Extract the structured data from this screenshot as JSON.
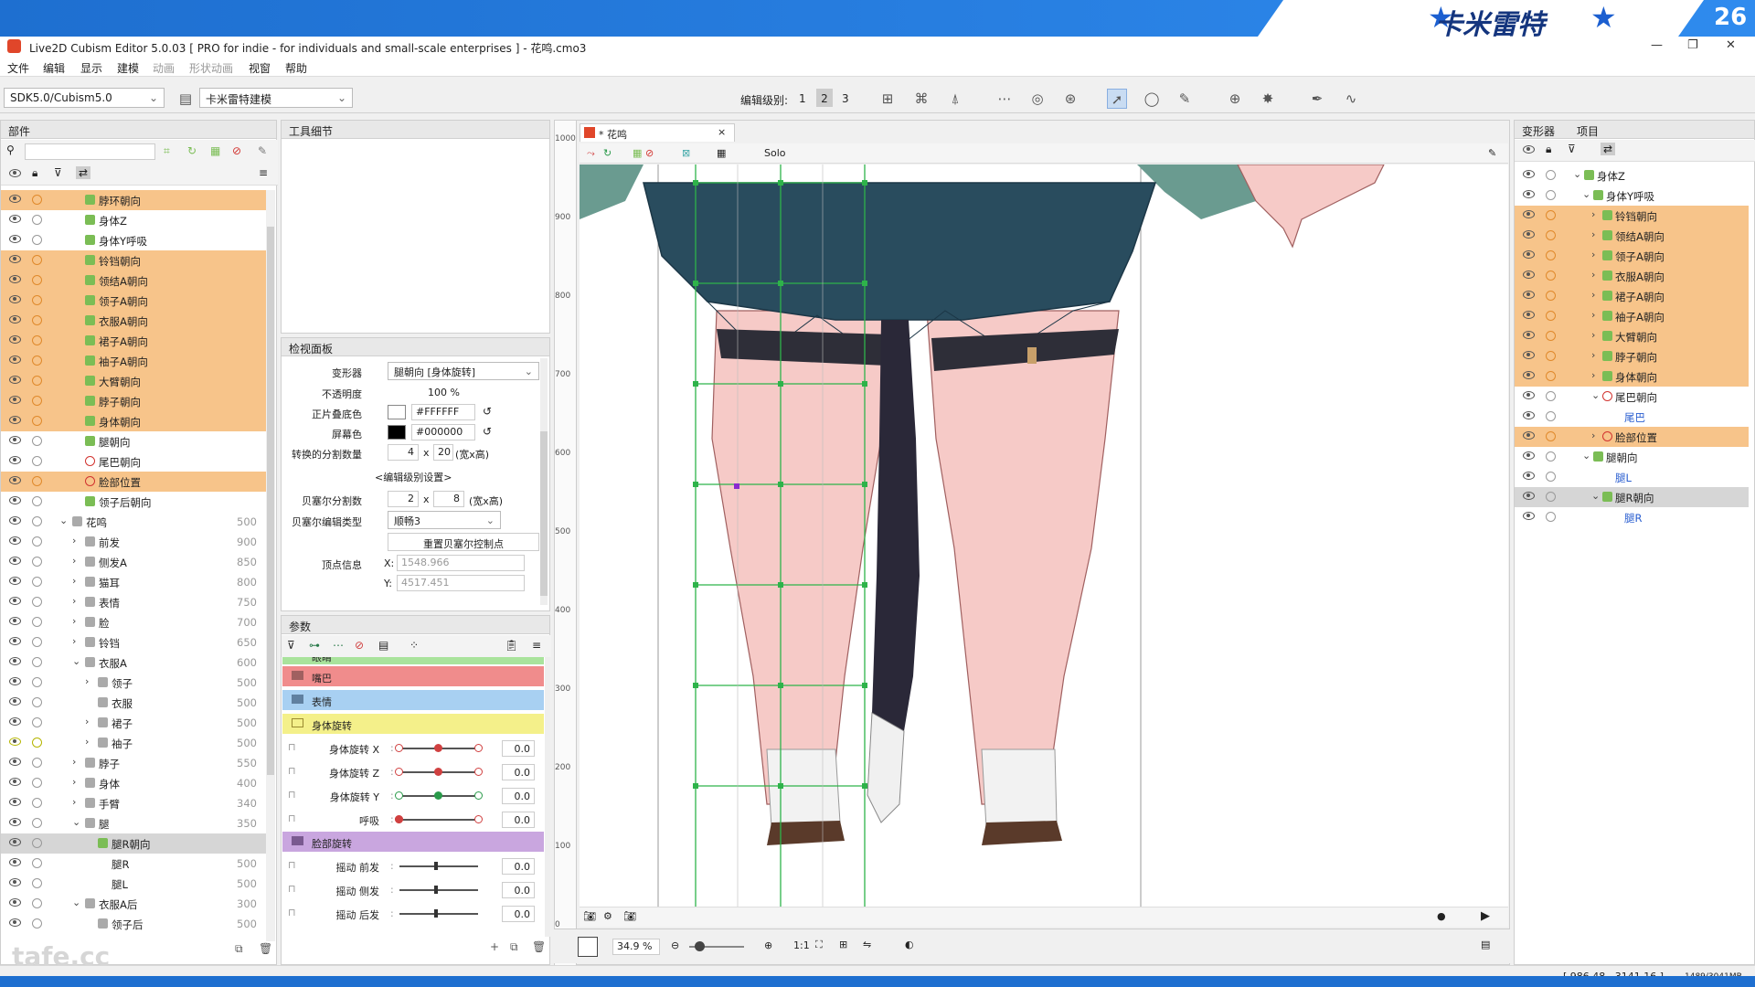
{
  "banner": {
    "brand": "卡米雷特",
    "number": "26"
  },
  "window": {
    "title": "Live2D Cubism Editor 5.0.03   [ PRO for indie - for individuals and small-scale enterprises ] - 花鸣.cmo3",
    "minimize": "—",
    "maximize": "❐",
    "close": "✕"
  },
  "menu": [
    "文件",
    "编辑",
    "显示",
    "建模",
    "动画",
    "形状动画",
    "视窗",
    "帮助"
  ],
  "toolbar": {
    "sdk": "SDK5.0/Cubism5.0",
    "workspace": "卡米雷特建模",
    "edit_level_label": "编辑级别:",
    "levels": [
      "1",
      "2",
      "3"
    ],
    "active_level": "2"
  },
  "parts_panel": {
    "tab": "部件",
    "search_placeholder": "",
    "rows": [
      {
        "label": "脖环朝向",
        "num": "",
        "hl": true,
        "icon": "g",
        "indent": 1
      },
      {
        "label": "身体Z",
        "num": "",
        "hl": false,
        "icon": "g",
        "indent": 1
      },
      {
        "label": "身体Y呼吸",
        "num": "",
        "hl": false,
        "icon": "g",
        "indent": 1
      },
      {
        "label": "铃铛朝向",
        "num": "",
        "hl": true,
        "icon": "g",
        "indent": 1
      },
      {
        "label": "领结A朝向",
        "num": "",
        "hl": true,
        "icon": "g",
        "indent": 1
      },
      {
        "label": "领子A朝向",
        "num": "",
        "hl": true,
        "icon": "g",
        "indent": 1
      },
      {
        "label": "衣服A朝向",
        "num": "",
        "hl": true,
        "icon": "g",
        "indent": 1
      },
      {
        "label": "裙子A朝向",
        "num": "",
        "hl": true,
        "icon": "g",
        "indent": 1
      },
      {
        "label": "袖子A朝向",
        "num": "",
        "hl": true,
        "icon": "g",
        "indent": 1
      },
      {
        "label": "大臂朝向",
        "num": "",
        "hl": true,
        "icon": "g",
        "indent": 1
      },
      {
        "label": "脖子朝向",
        "num": "",
        "hl": true,
        "icon": "g",
        "indent": 1
      },
      {
        "label": "身体朝向",
        "num": "",
        "hl": true,
        "icon": "g",
        "indent": 1
      },
      {
        "label": "腿朝向",
        "num": "",
        "hl": false,
        "icon": "g",
        "indent": 1
      },
      {
        "label": "尾巴朝向",
        "num": "",
        "hl": false,
        "icon": "r",
        "indent": 1
      },
      {
        "label": "脸部位置",
        "num": "",
        "hl": true,
        "icon": "r",
        "indent": 1
      },
      {
        "label": "领子后朝向",
        "num": "",
        "hl": false,
        "icon": "g",
        "indent": 1
      },
      {
        "label": "花鸣",
        "num": "500",
        "hl": false,
        "icon": "f",
        "indent": 0,
        "chev": "⌄"
      },
      {
        "label": "前发",
        "num": "900",
        "hl": false,
        "icon": "f",
        "indent": 1,
        "chev": "›"
      },
      {
        "label": "侧发A",
        "num": "850",
        "hl": false,
        "icon": "f",
        "indent": 1,
        "chev": "›"
      },
      {
        "label": "猫耳",
        "num": "800",
        "hl": false,
        "icon": "f",
        "indent": 1,
        "chev": "›"
      },
      {
        "label": "表情",
        "num": "750",
        "hl": false,
        "icon": "f",
        "indent": 1,
        "chev": "›"
      },
      {
        "label": "脸",
        "num": "700",
        "hl": false,
        "icon": "f",
        "indent": 1,
        "chev": "›"
      },
      {
        "label": "铃铛",
        "num": "650",
        "hl": false,
        "icon": "f",
        "indent": 1,
        "chev": "›"
      },
      {
        "label": "衣服A",
        "num": "600",
        "hl": false,
        "icon": "f",
        "indent": 1,
        "chev": "⌄"
      },
      {
        "label": "领子",
        "num": "500",
        "hl": false,
        "icon": "f",
        "indent": 2,
        "chev": "›"
      },
      {
        "label": "衣服",
        "num": "500",
        "hl": false,
        "icon": "f",
        "indent": 2
      },
      {
        "label": "裙子",
        "num": "500",
        "hl": false,
        "icon": "f",
        "indent": 2,
        "chev": "›"
      },
      {
        "label": "袖子",
        "num": "500",
        "hl": false,
        "icon": "f",
        "indent": 2,
        "chev": "›",
        "yellow": true
      },
      {
        "label": "脖子",
        "num": "550",
        "hl": false,
        "icon": "f",
        "indent": 1,
        "chev": "›"
      },
      {
        "label": "身体",
        "num": "400",
        "hl": false,
        "icon": "f",
        "indent": 1,
        "chev": "›"
      },
      {
        "label": "手臂",
        "num": "340",
        "hl": false,
        "icon": "f",
        "indent": 1,
        "chev": "›"
      },
      {
        "label": "腿",
        "num": "350",
        "hl": false,
        "icon": "f",
        "indent": 1,
        "chev": "⌄"
      },
      {
        "label": "腿R朝向",
        "num": "",
        "hl": false,
        "icon": "g",
        "indent": 2,
        "selected": true
      },
      {
        "label": "腿R",
        "num": "500",
        "hl": false,
        "icon": "",
        "indent": 2
      },
      {
        "label": "腿L",
        "num": "500",
        "hl": false,
        "icon": "",
        "indent": 2
      },
      {
        "label": "衣服A后",
        "num": "300",
        "hl": false,
        "icon": "f",
        "indent": 1,
        "chev": "⌄"
      },
      {
        "label": "领子后",
        "num": "500",
        "hl": false,
        "icon": "f",
        "indent": 2
      }
    ]
  },
  "tool_detail": {
    "tab": "工具细节"
  },
  "inspector": {
    "tab": "检视面板",
    "deformer_label": "变形器",
    "deformer_value": "腿朝向 [身体旋转]",
    "opacity_label": "不透明度",
    "opacity_value": "100 %",
    "multiply_label": "正片叠底色",
    "multiply_value": "#FFFFFF",
    "screen_label": "屏幕色",
    "screen_value": "#000000",
    "divisions_label": "转换的分割数量",
    "div_x": "4",
    "div_y": "20",
    "div_unit": "(宽x高)",
    "edit_level_settings": "<编辑级别设置>",
    "bezier_div_label": "贝塞尔分割数",
    "bez_x": "2",
    "bez_y": "8",
    "bez_unit": "(宽x高)",
    "bezier_type_label": "贝塞尔编辑类型",
    "bezier_type_value": "顺畅3",
    "reset_button": "重置贝塞尔控制点",
    "vertex_label": "顶点信息",
    "vx_label": "X:",
    "vx": "1548.966",
    "vy_label": "Y:",
    "vy": "4517.451",
    "x_sep": "x"
  },
  "params": {
    "tab": "参数",
    "groups": [
      {
        "label": "眼睛",
        "color": "#a9e39c",
        "partial": true
      },
      {
        "label": "嘴巴",
        "color": "#f08c8c"
      },
      {
        "label": "表情",
        "color": "#a8d0f2"
      },
      {
        "label": "身体旋转",
        "color": "#f4f08a"
      }
    ],
    "sliders_body": [
      {
        "name": "身体旋转  X",
        "value": "0.0",
        "pos": 0.5,
        "color": "#d04040"
      },
      {
        "name": "身体旋转  Z",
        "value": "0.0",
        "pos": 0.5,
        "color": "#d04040"
      },
      {
        "name": "身体旋转  Y",
        "value": "0.0",
        "pos": 0.5,
        "color": "#2a9a4a"
      },
      {
        "name": "呼吸",
        "value": "0.0",
        "pos": 0.0,
        "color": "#d04040"
      }
    ],
    "group2": {
      "label": "脸部旋转",
      "color": "#c9a6df"
    },
    "sliders_face": [
      {
        "name": "摇动 前发",
        "value": "0.0",
        "pos": 0.5
      },
      {
        "name": "摇动 侧发",
        "value": "0.0",
        "pos": 0.5
      },
      {
        "name": "摇动 后发",
        "value": "0.0",
        "pos": 0.5
      }
    ]
  },
  "editor": {
    "tab": "* 花鸣",
    "tab_close": "×",
    "solo": "Solo",
    "zoom": "34.9 %",
    "ratio": "1:1",
    "ruler": [
      "1000",
      "900",
      "800",
      "700",
      "600",
      "500",
      "400",
      "300",
      "200",
      "100",
      "0"
    ]
  },
  "deformer_panel": {
    "tabs": [
      "变形器",
      "项目"
    ],
    "rows": [
      {
        "label": "身体Z",
        "indent": 0,
        "chev": "⌄",
        "hl": false,
        "icon": "g"
      },
      {
        "label": "身体Y呼吸",
        "indent": 1,
        "chev": "⌄",
        "hl": false,
        "icon": "g"
      },
      {
        "label": "铃铛朝向",
        "indent": 2,
        "chev": "›",
        "hl": true,
        "icon": "g"
      },
      {
        "label": "领结A朝向",
        "indent": 2,
        "chev": "›",
        "hl": true,
        "icon": "g"
      },
      {
        "label": "领子A朝向",
        "indent": 2,
        "chev": "›",
        "hl": true,
        "icon": "g"
      },
      {
        "label": "衣服A朝向",
        "indent": 2,
        "chev": "›",
        "hl": true,
        "icon": "g"
      },
      {
        "label": "裙子A朝向",
        "indent": 2,
        "chev": "›",
        "hl": true,
        "icon": "g"
      },
      {
        "label": "袖子A朝向",
        "indent": 2,
        "chev": "›",
        "hl": true,
        "icon": "g"
      },
      {
        "label": "大臂朝向",
        "indent": 2,
        "chev": "›",
        "hl": true,
        "icon": "g"
      },
      {
        "label": "脖子朝向",
        "indent": 2,
        "chev": "›",
        "hl": true,
        "icon": "g"
      },
      {
        "label": "身体朝向",
        "indent": 2,
        "chev": "›",
        "hl": true,
        "icon": "g"
      },
      {
        "label": "尾巴朝向",
        "indent": 2,
        "chev": "⌄",
        "hl": false,
        "icon": "r"
      },
      {
        "label": "尾巴",
        "indent": 3,
        "chev": "",
        "hl": false,
        "icon": "",
        "blue": true
      },
      {
        "label": "脸部位置",
        "indent": 2,
        "chev": "›",
        "hl": true,
        "icon": "r"
      },
      {
        "label": "腿朝向",
        "indent": 1,
        "chev": "⌄",
        "hl": false,
        "icon": "g"
      },
      {
        "label": "腿L",
        "indent": 2,
        "chev": "",
        "hl": false,
        "icon": "",
        "blue": true
      },
      {
        "label": "腿R朝向",
        "indent": 2,
        "chev": "⌄",
        "hl": false,
        "icon": "g",
        "selected": true
      },
      {
        "label": "腿R",
        "indent": 3,
        "chev": "",
        "hl": false,
        "icon": "",
        "blue": true
      }
    ]
  },
  "status": {
    "coords": "[ 986.48 , 3141.16 ]",
    "memory": "1489/3041MB"
  },
  "watermark": "tafe.cc"
}
